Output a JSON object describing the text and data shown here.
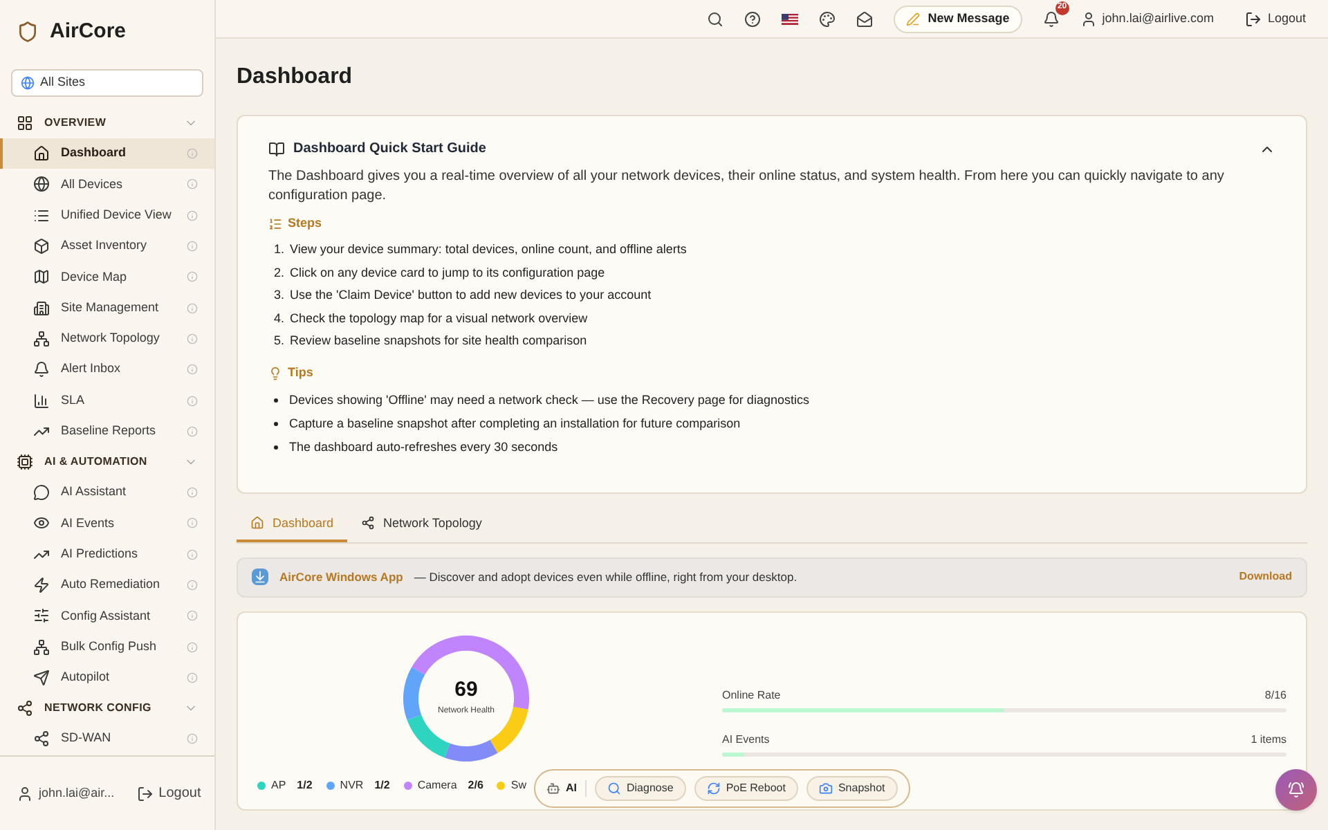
{
  "brand": {
    "name": "AirCore"
  },
  "site_selector": {
    "value": "All Sites"
  },
  "sidebar": {
    "sections": [
      {
        "title": "OVERVIEW",
        "expanded": true,
        "items": [
          {
            "label": "Dashboard",
            "selected": true
          },
          {
            "label": "All Devices",
            "selected": false
          },
          {
            "label": "Unified Device View",
            "selected": false
          },
          {
            "label": "Asset Inventory",
            "selected": false
          },
          {
            "label": "Device Map",
            "selected": false
          },
          {
            "label": "Site Management",
            "selected": false
          },
          {
            "label": "Network Topology",
            "selected": false
          },
          {
            "label": "Alert Inbox",
            "selected": false
          },
          {
            "label": "SLA",
            "selected": false
          },
          {
            "label": "Baseline Reports",
            "selected": false
          }
        ]
      },
      {
        "title": "AI & AUTOMATION",
        "expanded": true,
        "items": [
          {
            "label": "AI Assistant",
            "selected": false
          },
          {
            "label": "AI Events",
            "selected": false
          },
          {
            "label": "AI Predictions",
            "selected": false
          },
          {
            "label": "Auto Remediation",
            "selected": false
          },
          {
            "label": "Config Assistant",
            "selected": false
          },
          {
            "label": "Bulk Config Push",
            "selected": false
          },
          {
            "label": "Autopilot",
            "selected": false
          }
        ]
      },
      {
        "title": "NETWORK CONFIG",
        "expanded": true,
        "items": [
          {
            "label": "SD-WAN",
            "selected": false
          }
        ]
      }
    ],
    "user": "john.lai@air...",
    "logout": "Logout"
  },
  "topbar": {
    "new_message": "New Message",
    "notifications": "20",
    "user": "john.lai@airlive.com",
    "logout": "Logout"
  },
  "page_title": "Dashboard",
  "guide": {
    "title": "Dashboard Quick Start Guide",
    "expanded": true,
    "intro": "The Dashboard gives you a real-time overview of all your network devices, their online status, and system health. From here you can quickly navigate to any configuration page.",
    "steps_title": "Steps",
    "steps": [
      "View your device summary: total devices, online count, and offline alerts",
      "Click on any device card to jump to its configuration page",
      "Use the 'Claim Device' button to add new devices to your account",
      "Check the topology map for a visual network overview",
      "Review baseline snapshots for site health comparison"
    ],
    "step_numbers": [
      "1.",
      "2.",
      "3.",
      "4.",
      "5."
    ],
    "tips_title": "Tips",
    "tips": [
      "Devices showing 'Offline' may need a network check — use the Recovery page for diagnostics",
      "Capture a baseline snapshot after completing an installation for future comparison",
      "The dashboard auto-refreshes every 30 seconds"
    ]
  },
  "tabs": [
    {
      "label": "Dashboard",
      "selected": true
    },
    {
      "label": "Network Topology",
      "selected": false
    }
  ],
  "banner": {
    "title": "AirCore Windows App",
    "text": "— Discover and adopt devices even while offline, right from your desktop.",
    "action": "Download"
  },
  "health": {
    "score": "69",
    "label": "Network Health",
    "legend": [
      {
        "name": "AP",
        "value": "1/2",
        "color": "#2dd4bf"
      },
      {
        "name": "NVR",
        "value": "1/2",
        "color": "#60a5fa"
      },
      {
        "name": "Camera",
        "value": "2/6",
        "color": "#c084fc"
      },
      {
        "name": "Sw",
        "color": "#facc15"
      }
    ],
    "meters": [
      {
        "name": "Online Rate",
        "reading": "8/16",
        "level": 0.5
      },
      {
        "name": "AI Events",
        "reading": "1 items",
        "level": 0.04
      }
    ]
  },
  "ai_toolbar": {
    "label": "AI",
    "actions": [
      "Diagnose",
      "PoE Reboot",
      "Snapshot"
    ]
  }
}
